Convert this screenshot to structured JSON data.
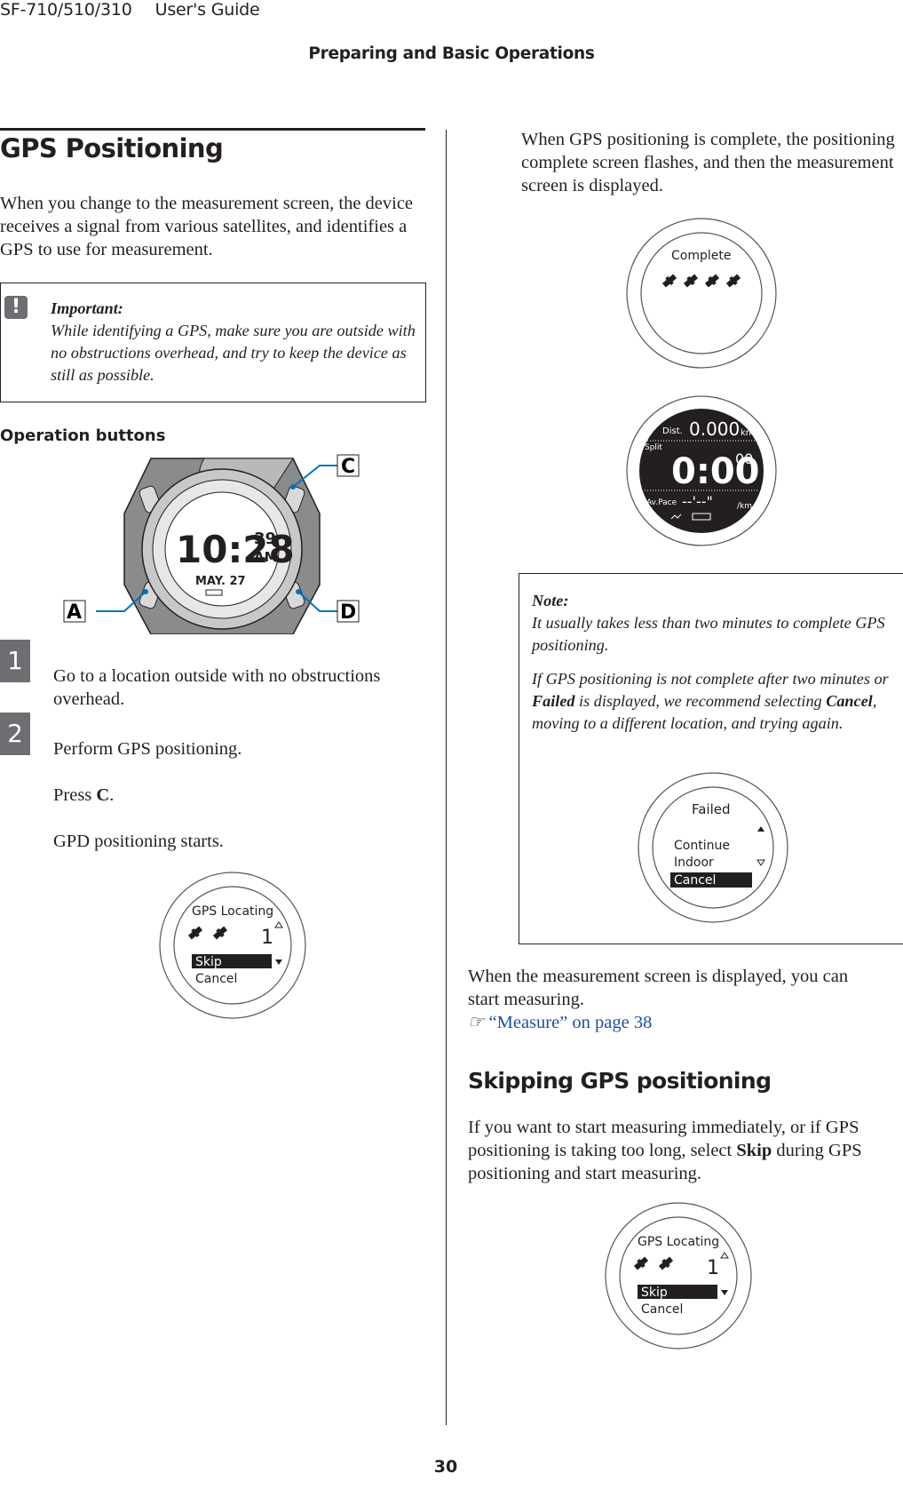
{
  "header": {
    "model": "SF-710/510/310",
    "guide": "User's Guide",
    "section": "Preparing and Basic Operations"
  },
  "left": {
    "title": "GPS Positioning",
    "intro": "When you change to the measurement screen, the device receives a signal from various satellites, and identifies a GPS to use for measurement.",
    "important": {
      "icon": "exclamation-icon",
      "label": "Important:",
      "text": "While identifying a GPS, make sure you are outside with no obstructions overhead, and try to keep the device as still as possible."
    },
    "operation_buttons_label": "Operation buttons",
    "watch": {
      "time": "10:28",
      "seconds": "39",
      "ampm": "AM",
      "date": "MAY. 27",
      "callouts": [
        "A",
        "C",
        "D"
      ]
    },
    "steps": [
      {
        "number": "1",
        "text": "Go to a location outside with no obstructions overhead."
      },
      {
        "number": "2",
        "text": "Perform GPS positioning.",
        "press_prefix": "Press ",
        "press_key": "C",
        "press_suffix": ".",
        "result": "GPD positioning starts."
      }
    ],
    "gps_screen": {
      "title": "GPS Locating",
      "count": "1",
      "options": [
        "Skip",
        "Cancel"
      ],
      "selected": "Skip"
    }
  },
  "right": {
    "complete_intro": "When GPS positioning is complete, the positioning complete screen flashes, and then the measurement screen is displayed.",
    "complete_screen": {
      "title": "Complete"
    },
    "measurement_screen": {
      "dist_label": "Dist.",
      "dist_value": "0.000",
      "dist_unit": "km",
      "split_label": "Split",
      "split_value": "0:00",
      "split_sub": "00",
      "pace_label": "Av.Pace",
      "pace_value": "--'--\"",
      "pace_unit": "/km"
    },
    "note": {
      "label": "Note:",
      "p1": "It usually takes less than two minutes to complete GPS positioning.",
      "p2_a": "If GPS positioning is not complete after two minutes or ",
      "p2_b": "Failed",
      "p2_c": " is displayed, we recommend selecting ",
      "p2_d": "Cancel",
      "p2_e": ", moving to a different location, and trying again."
    },
    "failed_screen": {
      "title": "Failed",
      "options": [
        "Continue",
        "Indoor",
        "Cancel"
      ],
      "selected": "Cancel"
    },
    "measure_text": "When the measurement screen is displayed, you can start measuring.",
    "measure_link": "“Measure” on page 38",
    "skip_title": "Skipping GPS positioning",
    "skip_text_a": "If you want to start measuring immediately, or if GPS positioning is taking too long, select ",
    "skip_text_b": "Skip",
    "skip_text_c": " during GPS positioning and start measuring.",
    "gps_screen": {
      "title": "GPS Locating",
      "count": "1",
      "options": [
        "Skip",
        "Cancel"
      ],
      "selected": "Skip"
    }
  },
  "footer": {
    "page": "30"
  }
}
